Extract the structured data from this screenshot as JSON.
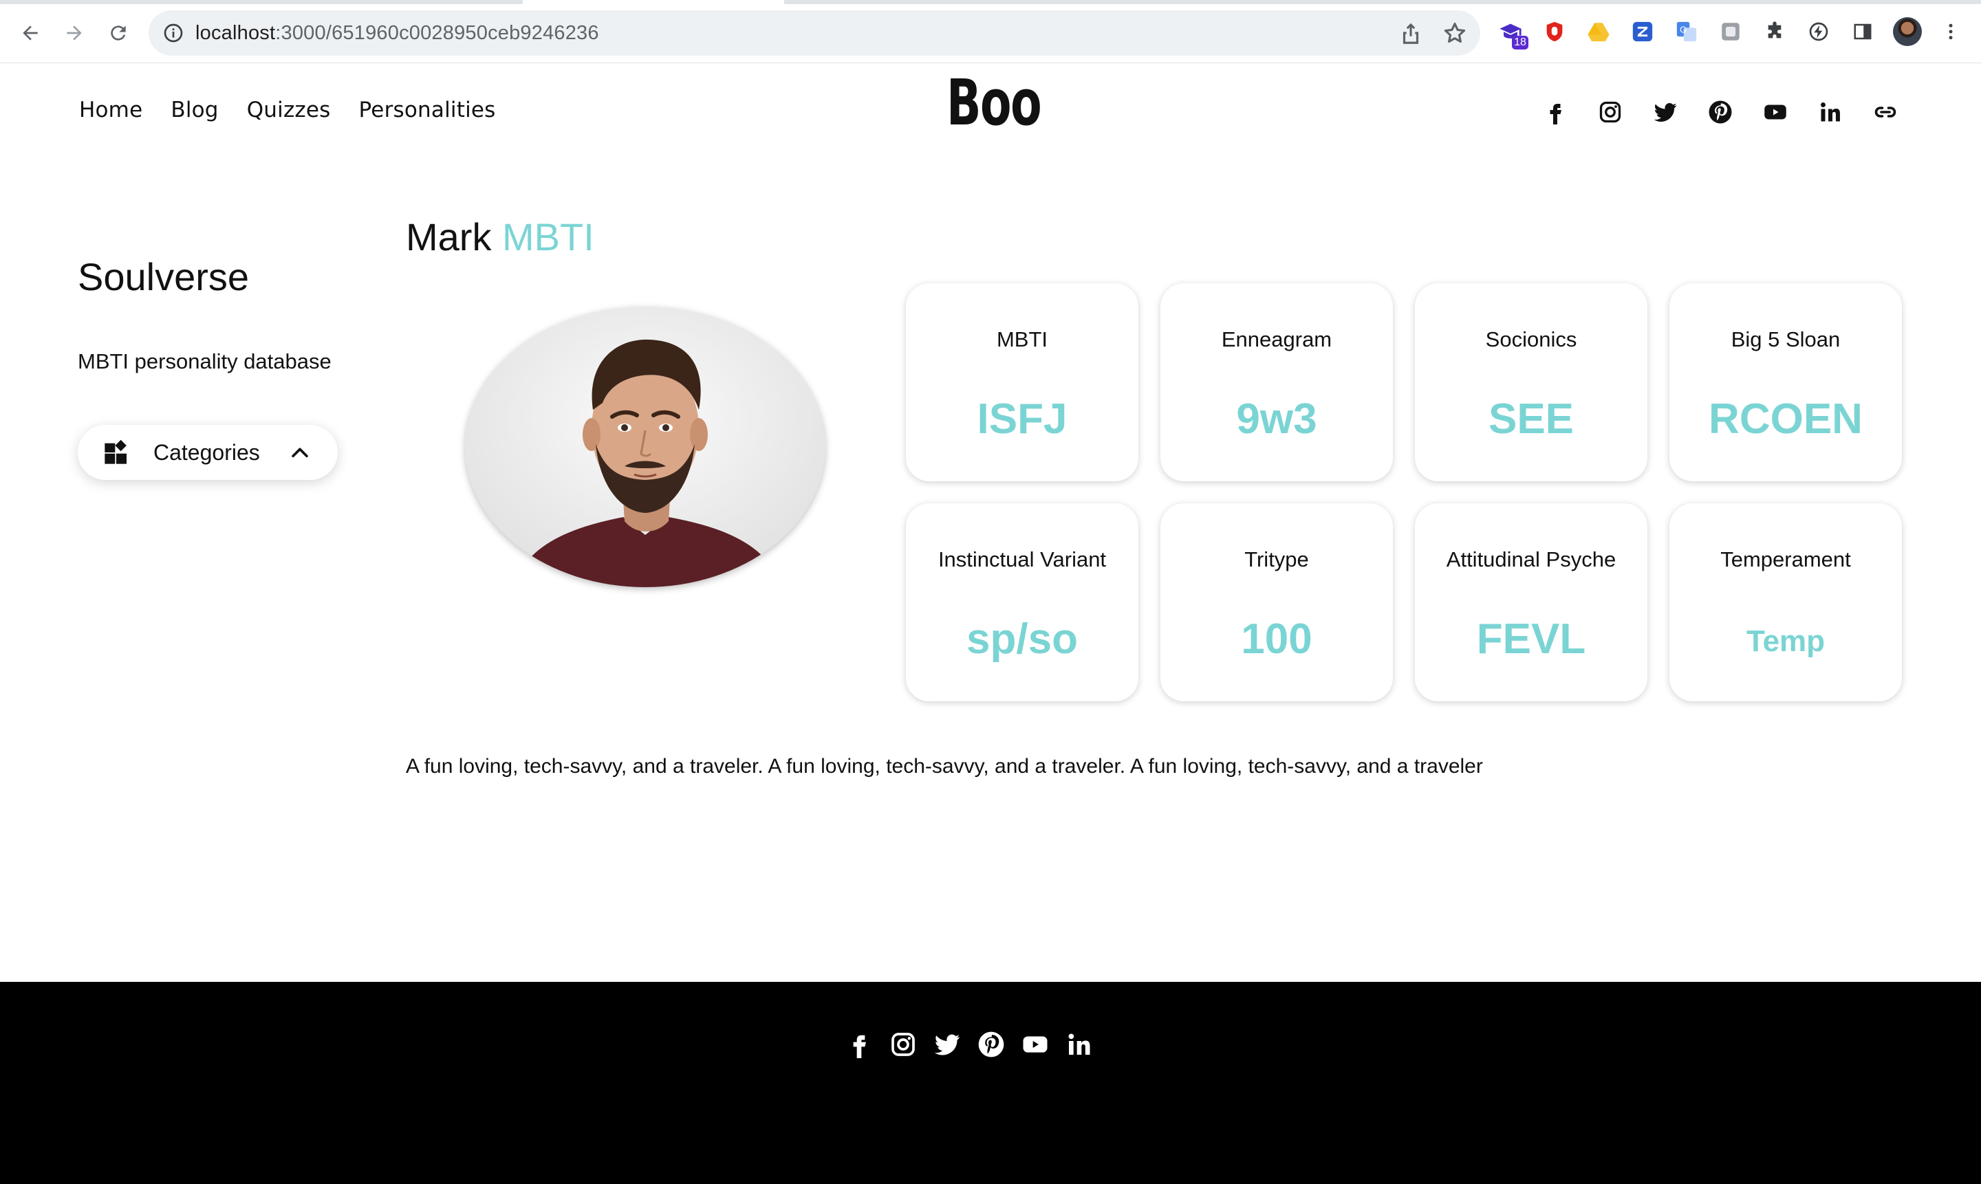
{
  "browser": {
    "url_host": "localhost",
    "url_path": ":3000/651960c0028950ceb9246236",
    "extensions": [
      {
        "name": "graduation-cap-extension-icon",
        "badge": "18",
        "color": "#4b2bc7"
      },
      {
        "name": "shield-extension-icon",
        "color": "#e0241b"
      },
      {
        "name": "drive-extension-icon",
        "color": "#f6c431"
      },
      {
        "name": "z-extension-icon",
        "color": "#2a5ecf"
      },
      {
        "name": "translate-extension-icon",
        "color": "#4a86e8"
      },
      {
        "name": "grey-extension-icon",
        "color": "#9aa0a6"
      },
      {
        "name": "puzzle-extension-icon",
        "color": "#3c4043"
      },
      {
        "name": "bolt-extension-icon",
        "color": "#3c4043"
      },
      {
        "name": "side-panel-icon",
        "color": "#3c4043"
      }
    ]
  },
  "nav": {
    "items": [
      "Home",
      "Blog",
      "Quizzes",
      "Personalities"
    ]
  },
  "logo": "Boo",
  "sidebar": {
    "title": "Soulverse",
    "subtitle": "MBTI personality database",
    "categories_label": "Categories"
  },
  "profile": {
    "name": "Mark",
    "type_word": "MBTI",
    "description": "A fun loving, tech-savvy, and a traveler. A fun loving, tech-savvy, and a traveler. A fun loving, tech-savvy, and a traveler"
  },
  "cards": [
    {
      "label": "MBTI",
      "value": "ISFJ"
    },
    {
      "label": "Enneagram",
      "value": "9w3"
    },
    {
      "label": "Socionics",
      "value": "SEE"
    },
    {
      "label": "Big 5 Sloan",
      "value": "RCOEN"
    },
    {
      "label": "Instinctual Variant",
      "value": "sp/so"
    },
    {
      "label": "Tritype",
      "value": "100"
    },
    {
      "label": "Attitudinal Psyche",
      "value": "FEVL"
    },
    {
      "label": "Temperament",
      "value": "Temp"
    }
  ],
  "colors": {
    "accent": "#7bd4d4",
    "footer_bg": "#000000"
  }
}
